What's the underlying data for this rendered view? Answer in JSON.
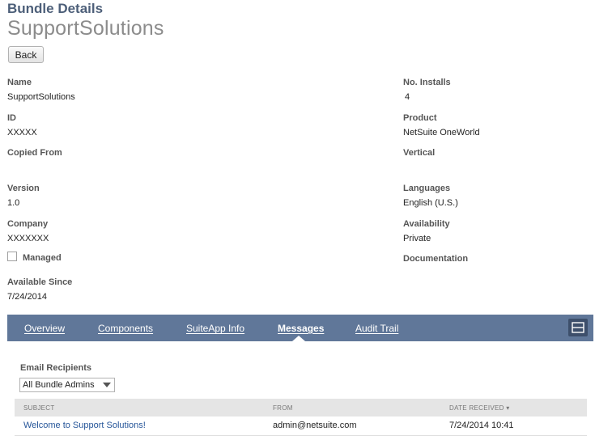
{
  "header": {
    "label": "Bundle Details",
    "bundle_name": "SupportSolutions"
  },
  "back_label": "Back",
  "fields": {
    "name": {
      "label": "Name",
      "value": "SupportSolutions"
    },
    "id": {
      "label": "ID",
      "value": "XXXXX"
    },
    "copied_from": {
      "label": "Copied From",
      "value": ""
    },
    "version": {
      "label": "Version",
      "value": "1.0"
    },
    "company": {
      "label": "Company",
      "value": "XXXXXXX"
    },
    "managed": {
      "label": "Managed",
      "checked": false
    },
    "available_since": {
      "label": "Available Since",
      "value": "7/24/2014"
    },
    "installs": {
      "label": "No. Installs",
      "value": "4"
    },
    "product": {
      "label": "Product",
      "value": "NetSuite OneWorld"
    },
    "vertical": {
      "label": "Vertical",
      "value": ""
    },
    "languages": {
      "label": "Languages",
      "value": "English (U.S.)"
    },
    "availability": {
      "label": "Availability",
      "value": "Private"
    },
    "documentation": {
      "label": "Documentation",
      "value": ""
    }
  },
  "tabs": [
    {
      "label": "Overview",
      "active": false
    },
    {
      "label": "Components",
      "active": false
    },
    {
      "label": "SuiteApp Info",
      "active": false
    },
    {
      "label": "Messages",
      "active": true
    },
    {
      "label": "Audit Trail",
      "active": false
    }
  ],
  "messages": {
    "recipients_label": "Email Recipients",
    "recipients_selected": "All Bundle Admins",
    "columns": [
      "SUBJECT",
      "FROM",
      "DATE RECEIVED ▾"
    ],
    "rows": [
      {
        "subject": "Welcome to Support Solutions!",
        "from": "admin@netsuite.com",
        "date": "7/24/2014 10:41"
      }
    ]
  },
  "colors": {
    "tab_bar": "#607799",
    "title": "#4d5f79",
    "link": "#255599"
  }
}
